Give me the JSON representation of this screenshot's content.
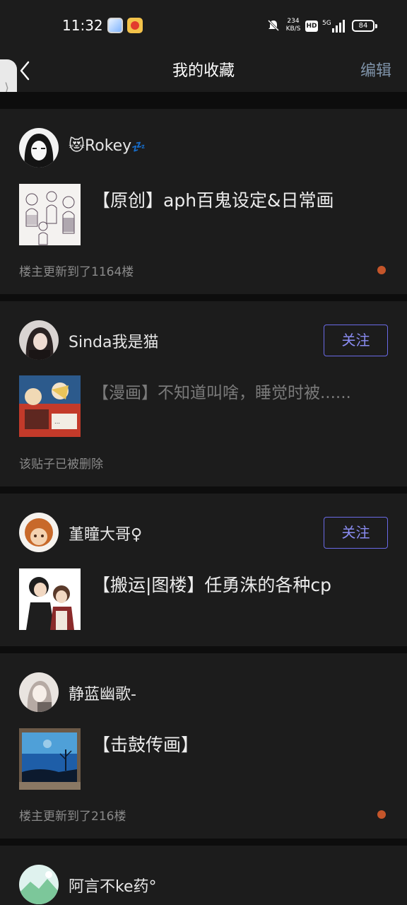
{
  "status_bar": {
    "time": "11:32",
    "net_speed_value": "234",
    "net_speed_unit": "KB/S",
    "hd": "HD",
    "network": "5G",
    "battery": "84"
  },
  "nav": {
    "title": "我的收藏",
    "edit_label": "编辑"
  },
  "colors": {
    "background": "#0d0d0d",
    "card": "#1c1c1c",
    "follow_accent": "#8a8cf2",
    "edit_accent": "#7f93a9",
    "update_dot": "#c4552a"
  },
  "posts": [
    {
      "username_emoji_prefix": "😻",
      "username": "Rokey",
      "username_emoji_suffix": "💤",
      "follow_label": "",
      "title": "【原创】aph百鬼设定&日常画",
      "meta": "楼主更新到了1164楼",
      "has_update_dot": true
    },
    {
      "username": "Sinda我是猫",
      "follow_label": "关注",
      "title": "【漫画】不知道叫啥，睡觉时被......",
      "meta": "该贴子已被删除",
      "has_update_dot": false
    },
    {
      "username": "堇瞳大哥♀",
      "follow_label": "关注",
      "title": "【搬运|图楼】任勇洙的各种cp",
      "meta": "",
      "has_update_dot": false
    },
    {
      "username": "静蓝幽歌-",
      "follow_label": "",
      "title": "【击鼓传画】",
      "meta": "楼主更新到了216楼",
      "has_update_dot": true
    },
    {
      "username": "阿言不ke药°",
      "follow_label": "",
      "title": "",
      "meta": "",
      "has_update_dot": false
    }
  ]
}
